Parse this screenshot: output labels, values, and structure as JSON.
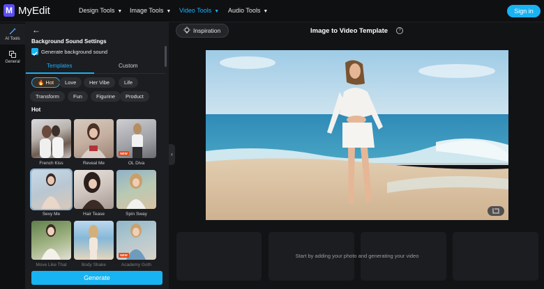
{
  "app": {
    "brand": "MyEdit",
    "logo_letter": "M"
  },
  "nav": [
    {
      "label": "Design Tools",
      "active": false
    },
    {
      "label": "Image Tools",
      "active": false
    },
    {
      "label": "Video Tools",
      "active": true
    },
    {
      "label": "Audio Tools",
      "active": false
    }
  ],
  "signin_label": "Sign in",
  "rail": [
    {
      "label": "AI Tools",
      "icon": "magic-wand-icon",
      "active": true
    },
    {
      "label": "General",
      "icon": "layers-icon",
      "active": false
    }
  ],
  "panel": {
    "back_icon": "back-arrow-icon",
    "title": "Background Sound Settings",
    "checkbox_label": "Generate background sound",
    "checkbox_checked": true,
    "tabs": [
      "Templates",
      "Custom"
    ],
    "chips": [
      "🔥 Hot",
      "Love",
      "Her Vibe",
      "Life",
      "Transform",
      "Fun",
      "Figurine",
      "Product"
    ],
    "section_title": "Hot",
    "new_badge": "NEW",
    "templates": [
      {
        "label": "French Kiss"
      },
      {
        "label": "Reveal Me"
      },
      {
        "label": "OL Diva",
        "new": true
      },
      {
        "label": "Sexy Me",
        "selected": true
      },
      {
        "label": "Hair Tease"
      },
      {
        "label": "Spin Sway"
      },
      {
        "label": "Move Like That"
      },
      {
        "label": "Body Shake"
      },
      {
        "label": "Academy Goth",
        "new": true
      }
    ],
    "generate_label": "Generate"
  },
  "main": {
    "inspiration_label": "Inspiration",
    "title": "Image to Video Template",
    "empty_text": "Start by adding your photo and generating your video"
  },
  "colors": {
    "accent": "#18b3f2",
    "panel": "#1c1d20",
    "bg": "#121315"
  }
}
